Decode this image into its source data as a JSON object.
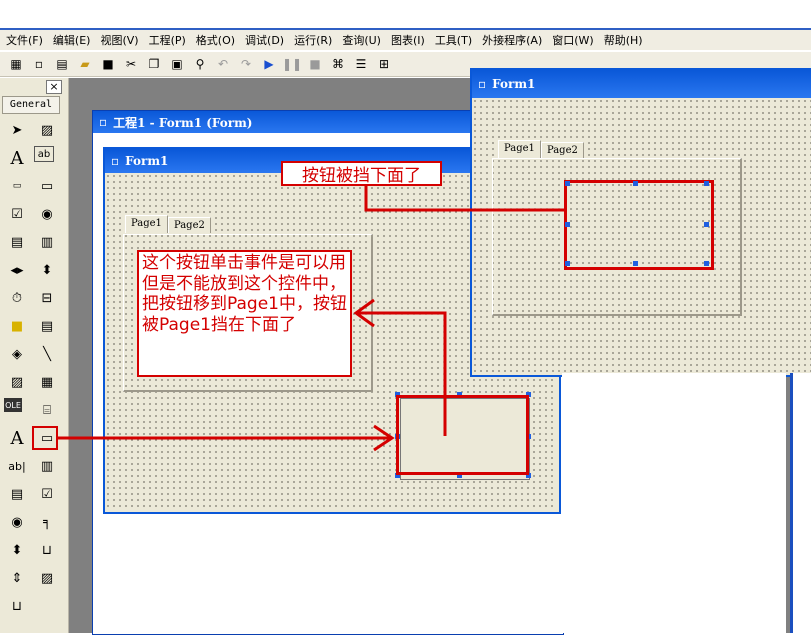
{
  "menu": [
    "文件(F)",
    "编辑(E)",
    "视图(V)",
    "工程(P)",
    "格式(O)",
    "调试(D)",
    "运行(R)",
    "查询(U)",
    "图表(I)",
    "工具(T)",
    "外接程序(A)",
    "窗口(W)",
    "帮助(H)"
  ],
  "toolbox": {
    "tab_label": "General",
    "close_glyph": "×"
  },
  "project_window": {
    "title": "工程1 - Form1 (Form)"
  },
  "form_left": {
    "title": "Form1",
    "tabs": [
      "Page1",
      "Page2"
    ]
  },
  "form_right": {
    "title": "Form1",
    "tabs": [
      "Page1",
      "Page2"
    ]
  },
  "annotations": {
    "top_label": "按钮被挡下面了",
    "left_note": "这个按钮单击事件是可以用但是不能放到这个控件中，把按钮移到Page1中，按钮被Page1挡在下面了"
  },
  "colors": {
    "annotation_red": "#d40000",
    "title_blue": "#0a58d8",
    "form_bg": "#ece9d8"
  },
  "icons": [
    "new-project-icon",
    "add-form-icon",
    "menu-editor-icon",
    "open-icon",
    "save-icon",
    "cut-icon",
    "copy-icon",
    "paste-icon",
    "find-icon",
    "undo-icon",
    "redo-icon",
    "run-icon",
    "pause-icon",
    "stop-icon",
    "project-explorer-icon",
    "properties-icon",
    "form-layout-icon"
  ]
}
